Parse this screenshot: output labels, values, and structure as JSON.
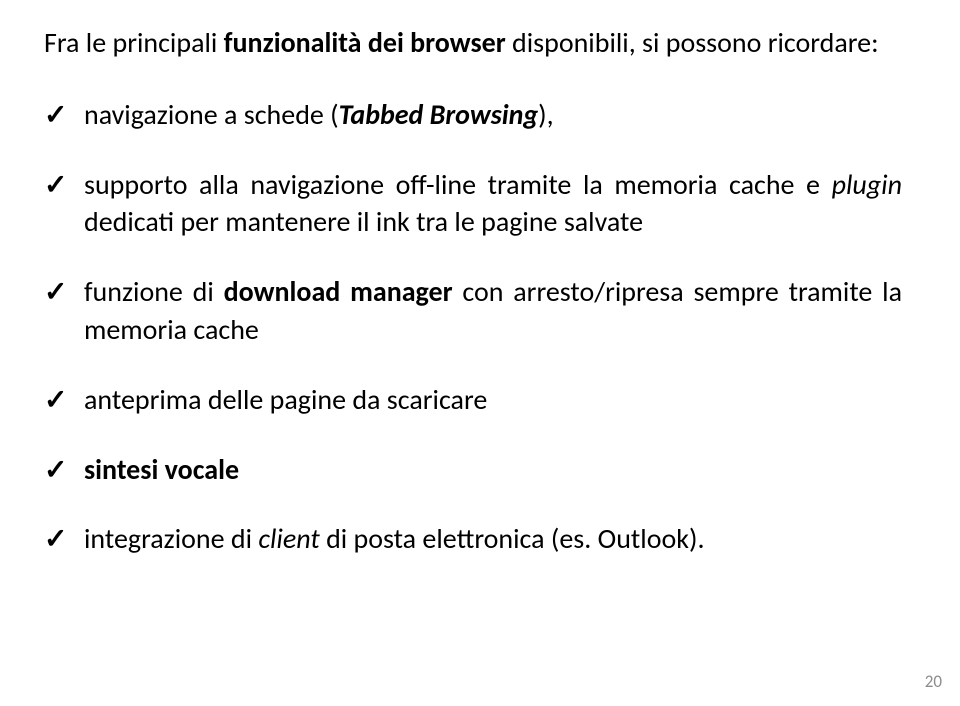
{
  "intro": {
    "t1": "Fra le principali ",
    "t2": "funzionalità dei browser",
    "t3": " disponibili, si possono ricordare:"
  },
  "items": [
    {
      "parts": [
        {
          "text": "navigazione a schede (",
          "cls": ""
        },
        {
          "text": "Tabbed Browsing",
          "cls": "bi"
        },
        {
          "text": "),",
          "cls": ""
        }
      ]
    },
    {
      "parts": [
        {
          "text": "supporto alla navigazione off-line tramite la memoria cache e ",
          "cls": ""
        },
        {
          "text": "plugin",
          "cls": "i"
        },
        {
          "text": " dedicati per mantenere il ink tra le pagine salvate",
          "cls": ""
        }
      ]
    },
    {
      "parts": [
        {
          "text": "funzione di ",
          "cls": ""
        },
        {
          "text": "download manager",
          "cls": "b"
        },
        {
          "text": " con arresto/ripresa sempre tramite la memoria cache",
          "cls": ""
        }
      ]
    },
    {
      "parts": [
        {
          "text": "anteprima delle pagine da scaricare",
          "cls": ""
        }
      ]
    },
    {
      "parts": [
        {
          "text": "sintesi vocale",
          "cls": "b"
        }
      ]
    },
    {
      "parts": [
        {
          "text": "integrazione di ",
          "cls": ""
        },
        {
          "text": "client",
          "cls": "i"
        },
        {
          "text": " di posta elettronica (es. Outlook).",
          "cls": ""
        }
      ]
    }
  ],
  "page_number": "20"
}
